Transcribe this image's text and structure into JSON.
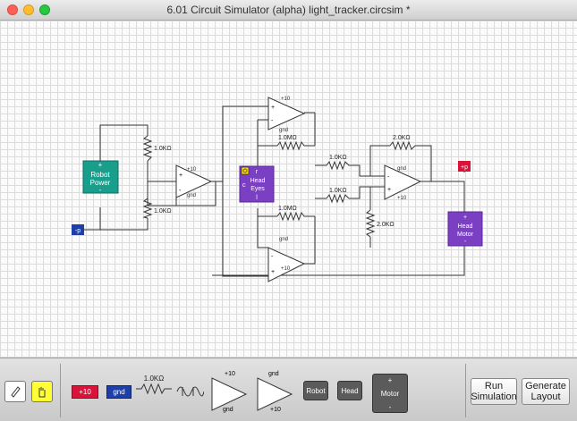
{
  "window": {
    "title": "6.01 Circuit Simulator (alpha) light_tracker.circsim *"
  },
  "circuit": {
    "resistors": {
      "r_top": "1.0KΩ",
      "r_bottom": "1.0KΩ",
      "r_fb_top": "1.0MΩ",
      "r_fb_bottom": "1.0MΩ",
      "r_sum_top": "1.0KΩ",
      "r_sum_bottom": "1.0KΩ",
      "r_fb_out": "2.0KΩ",
      "r_ground": "2.0KΩ"
    },
    "opamp_rail_pos": "+10",
    "opamp_rail_gnd": "gnd",
    "robot_power": {
      "plus": "+",
      "line1": "Robot",
      "line2": "Power",
      "minus": "-"
    },
    "head_eyes": {
      "r": "r",
      "c": "c",
      "l": "l",
      "line1": "Head",
      "line2": "Eyes"
    },
    "head_motor": {
      "plus": "+",
      "line1": "Head",
      "line2": "Motor",
      "minus": "-"
    },
    "probe_left": "-p",
    "probe_right": "+p"
  },
  "toolbar": {
    "palette_plus10": "+10",
    "palette_gnd": "gnd",
    "palette_resistor": "1.0KΩ",
    "palette_opamp1_top": "+10",
    "palette_opamp1_bottom": "gnd",
    "palette_opamp2_top": "gnd",
    "palette_opamp2_bottom": "+10",
    "palette_robot": "Robot",
    "palette_head": "Head",
    "palette_motor_plus": "+",
    "palette_motor": "Motor",
    "palette_motor_minus": "-",
    "run_line1": "Run",
    "run_line2": "Simulation",
    "gen_line1": "Generate",
    "gen_line2": "Layout"
  },
  "colors": {
    "robot_power": "#1a9e8c",
    "head": "#7b3fc4",
    "probe_plus": "#d8143a",
    "probe_minus": "#1f3fa8",
    "hand_tool": "#ffff33",
    "dark_component": "#5b5b5b"
  }
}
